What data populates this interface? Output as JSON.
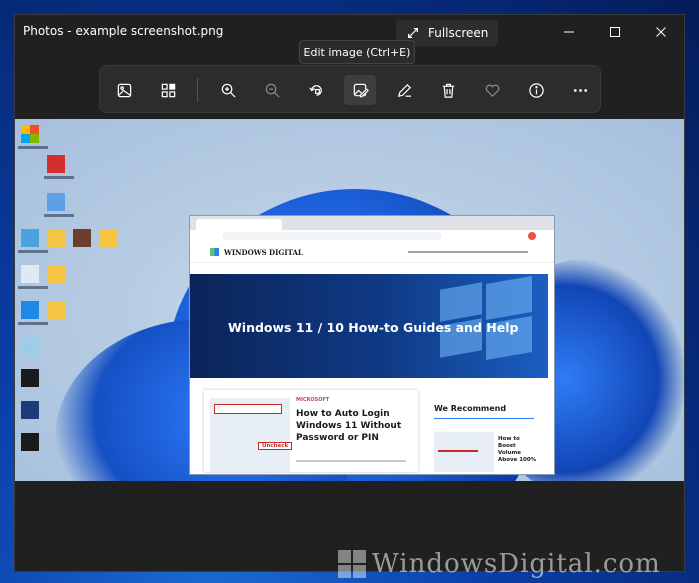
{
  "window": {
    "title": "Photos - example screenshot.png",
    "fullscreen_label": "Fullscreen"
  },
  "tooltip": "Edit image (Ctrl+E)",
  "toolbar": {
    "icons": [
      "image-icon",
      "gallery-icon",
      "zoom-in-icon",
      "zoom-out-icon",
      "rotate-icon",
      "edit-image-icon",
      "markup-pen-icon",
      "delete-icon",
      "favorite-heart-icon",
      "info-icon",
      "more-icon"
    ]
  },
  "screenshot": {
    "hero_title": "Windows 11 / 10 How-to Guides and Help",
    "article_category": "MICROSOFT",
    "article_title": "How to Auto Login Windows 11 Without Password or PIN",
    "uncheck_label": "Uncheck",
    "sidebar_heading": "We Recommend",
    "sidebar_article": "How to Boost Volume Above 100%",
    "site_logo": "WINDOWS DIGITAL"
  },
  "watermark": "WindowsDigital.com",
  "colors": {
    "window_bg": "#202020",
    "toolbar_bg": "#2c2c2c",
    "accent": "#1a5fc0"
  }
}
